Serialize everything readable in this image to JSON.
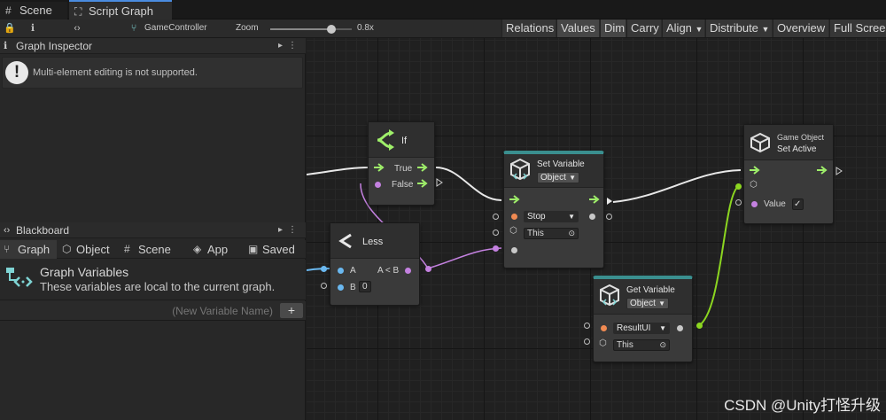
{
  "tabs": {
    "scene": "Scene",
    "script_graph": "Script Graph"
  },
  "toolbar": {
    "game_controller": "GameController",
    "zoom_label": "Zoom",
    "zoom_value": "0.8x",
    "zoom_level": 0.75,
    "relations": "Relations",
    "values": "Values",
    "dim": "Dim",
    "carry": "Carry",
    "align": "Align",
    "distribute": "Distribute",
    "overview": "Overview",
    "full_screen": "Full Screen"
  },
  "inspector": {
    "title": "Graph Inspector",
    "warning": "Multi-element editing is not supported."
  },
  "blackboard": {
    "title": "Blackboard",
    "tabs": [
      "Graph",
      "Object",
      "Scene",
      "App",
      "Saved"
    ],
    "variables_title": "Graph Variables",
    "variables_desc": "These variables are local to the current graph.",
    "new_variable_placeholder": "(New Variable Name)",
    "add_label": "+"
  },
  "nodes": {
    "if": {
      "title": "If",
      "true_port": "True",
      "false_port": "False"
    },
    "less": {
      "title": "Less",
      "input_a": "A",
      "input_b": "B",
      "b_value": "0",
      "output": "A < B"
    },
    "set_variable": {
      "title": "Set Variable",
      "kind": "Object",
      "name_value": "Stop",
      "target_value": "This"
    },
    "get_variable": {
      "title": "Get Variable",
      "kind": "Object",
      "name_value": "ResultUI",
      "target_value": "This"
    },
    "set_active": {
      "category": "Game Object",
      "title": "Set Active",
      "value_label": "Value",
      "value_checked": true,
      "check_glyph": "✓"
    }
  },
  "colors": {
    "control_flow": "#9ff06a",
    "bool_port": "#c481e0",
    "float_port": "#6ab8f0",
    "object_port": "#c8c8c8",
    "string_port": "#f08a52",
    "wire_object": "#8cd620",
    "teal_header": "#3a8f8f",
    "accent_tab": "#4a8ce0"
  },
  "watermark": "CSDN @Unity打怪升级"
}
